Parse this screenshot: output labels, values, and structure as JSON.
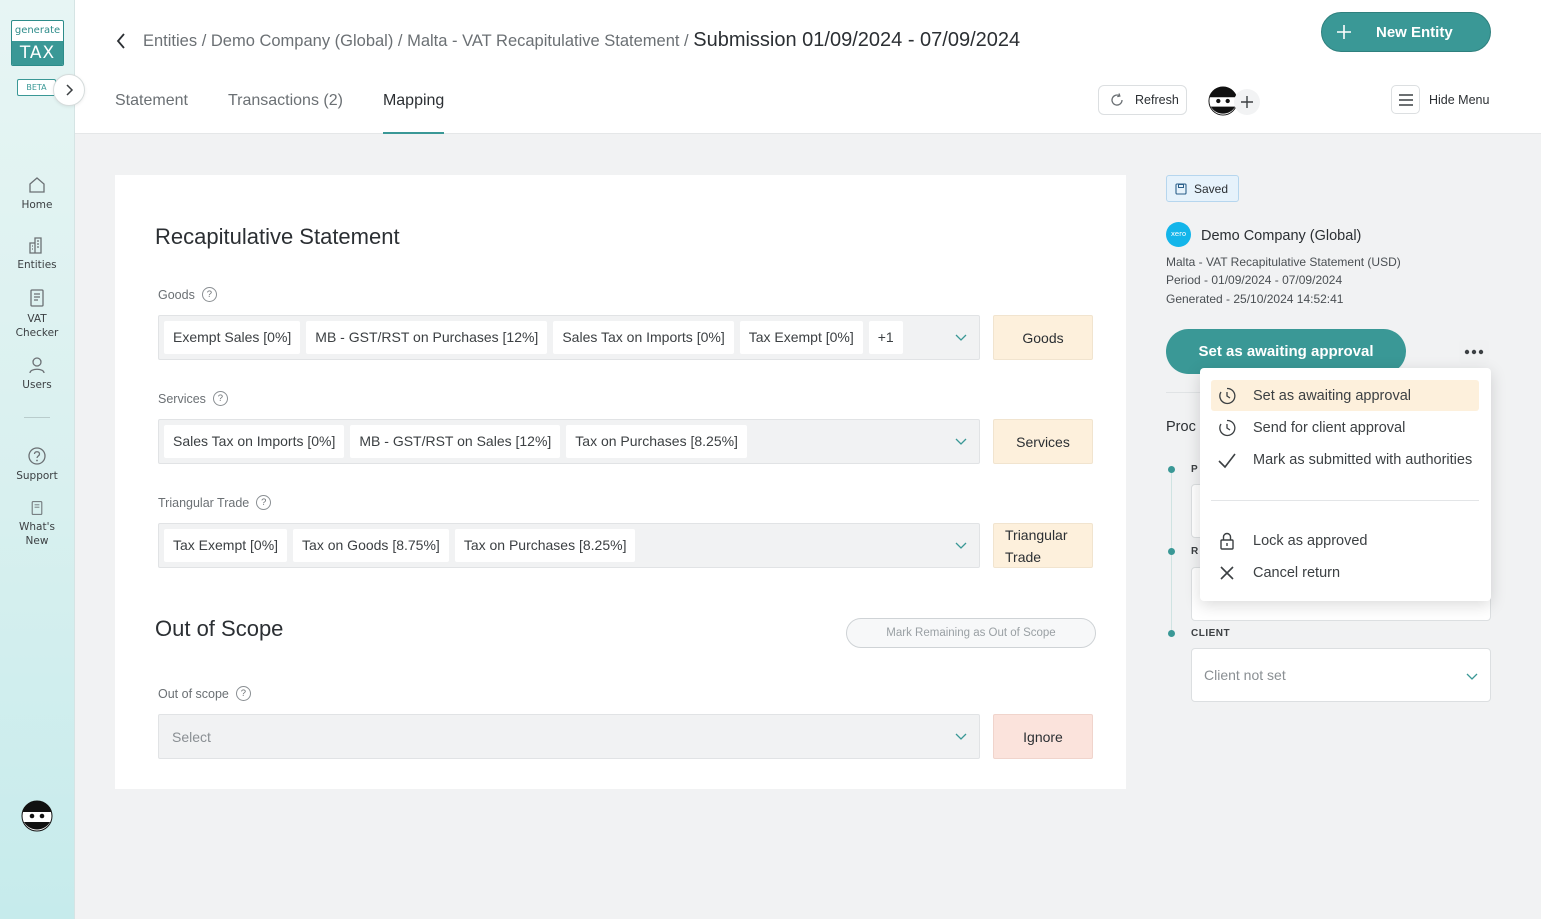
{
  "sidebar": {
    "logo_top": "generate",
    "logo_bottom": "TAX",
    "beta": "BETA",
    "items": [
      {
        "label": "Home"
      },
      {
        "label": "Entities"
      },
      {
        "label": "VAT Checker"
      },
      {
        "label": "Users"
      },
      {
        "label": "Support"
      },
      {
        "label": "What's New"
      }
    ]
  },
  "header": {
    "breadcrumb_prefix": "Entities / Demo Company (Global) / Malta - VAT Recapitulative Statement / ",
    "breadcrumb_current": "Submission 01/09/2024 - 07/09/2024",
    "new_entity": "New Entity",
    "refresh": "Refresh",
    "hide_menu": "Hide Menu",
    "tabs": [
      {
        "label": "Statement",
        "active": false
      },
      {
        "label": "Transactions (2)",
        "active": false
      },
      {
        "label": "Mapping",
        "active": true
      }
    ]
  },
  "main": {
    "title": "Recapitulative Statement",
    "goods": {
      "label": "Goods",
      "chips": [
        "Exempt Sales [0%]",
        "MB - GST/RST on Purchases [12%]",
        "Sales Tax on Imports [0%]",
        "Tax Exempt [0%]",
        "+1"
      ],
      "tag": "Goods"
    },
    "services": {
      "label": "Services",
      "chips": [
        "Sales Tax on Imports [0%]",
        "MB - GST/RST on Sales [12%]",
        "Tax on Purchases [8.25%]"
      ],
      "tag": "Services"
    },
    "triangular": {
      "label": "Triangular Trade",
      "chips": [
        "Tax Exempt [0%]",
        "Tax on Goods [8.75%]",
        "Tax on Purchases [8.25%]"
      ],
      "tag_line1": "Triangular",
      "tag_line2": "Trade"
    },
    "out_of_scope": {
      "title": "Out of Scope",
      "mark_button": "Mark Remaining as Out of Scope",
      "label": "Out of scope",
      "placeholder": "Select",
      "tag": "Ignore"
    }
  },
  "right_panel": {
    "saved": "Saved",
    "company": "Demo Company (Global)",
    "xero_logo_text": "xero",
    "statement_line": "Malta - VAT Recapitulative Statement (USD)",
    "period_line": "Period - 01/09/2024 - 07/09/2024",
    "generated_line": "Generated - 25/10/2024 14:52:41",
    "status_button": "Set as awaiting approval",
    "process_label": "Proc",
    "timeline_label_1": "P",
    "timeline_label_2": "R",
    "client_label": "CLIENT",
    "client_placeholder": "Client not set"
  },
  "dropdown": {
    "items": [
      {
        "label": "Set as awaiting approval",
        "icon": "clock-icon",
        "highlight": true
      },
      {
        "label": "Send for client approval",
        "icon": "clock-icon"
      },
      {
        "label": "Mark as submitted with authorities",
        "icon": "check-icon"
      },
      {
        "label": "Lock as approved",
        "icon": "lock-icon"
      },
      {
        "label": "Cancel return",
        "icon": "close-icon"
      }
    ]
  },
  "colors": {
    "accent": "#3a9896",
    "tag_bg": "#fdf0dc",
    "ignore_bg": "#fbe3dc",
    "sidebar_bg": "#d8f0ef"
  }
}
